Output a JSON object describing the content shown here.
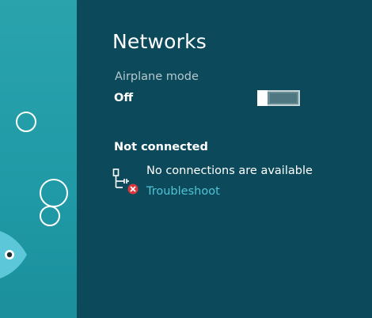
{
  "panel": {
    "title": "Networks"
  },
  "airplane_mode": {
    "label": "Airplane mode",
    "state": "Off",
    "on": false
  },
  "connection": {
    "heading": "Not connected",
    "status": "No connections are available",
    "troubleshoot_link": "Troubleshoot",
    "icon": "network-disconnected-icon"
  },
  "colors": {
    "panel_background": "#0c4a5b",
    "desktop_background": "#1f9aa6",
    "link": "#4fc3d6",
    "secondary_text": "#b5c8ce",
    "error_badge": "#d9363e"
  }
}
